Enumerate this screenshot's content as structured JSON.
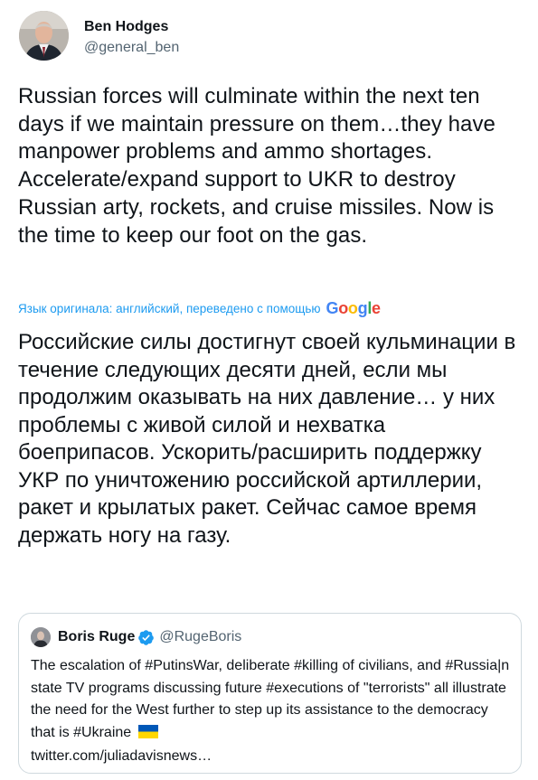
{
  "tweet": {
    "author": {
      "display_name": "Ben Hodges",
      "handle": "@general_ben"
    },
    "text": "Russian forces will culminate within the next ten days if we maintain pressure on them…they have manpower problems and ammo shortages. Accelerate/expand support to UKR to destroy Russian arty, rockets, and cruise missiles. Now is the time to keep our foot on the gas.",
    "translation_note": "Язык оригинала: английский, переведено с помощью",
    "translation_provider": "Google",
    "translated_text": "Российские силы достигнут своей кульминации в течение следующих десяти дней, если мы продолжим оказывать на них давление… у них проблемы с живой силой и нехватка боеприпасов. Ускорить/расширить поддержку УКР по уничтожению российской артиллерии, ракет и крылатых ракет. Сейчас самое время держать ногу на газу."
  },
  "quoted_tweet": {
    "author": {
      "display_name": "Boris Ruge",
      "handle": "@RugeBoris",
      "verified": true
    },
    "text": "The escalation of #PutinsWar, deliberate #killing of civilians, and #Russia|n state TV programs discussing future #executions of \"terrorists\" all illustrate the need for the West further to step up its assistance to the democracy that is #Ukraine",
    "link": "twitter.com/juliadavisnews…"
  },
  "colors": {
    "text": "#0f1419",
    "secondary_text": "#536471",
    "link_blue": "#1d9bf0",
    "border": "#cfd9de",
    "verified_badge": "#1d9bf0"
  },
  "icons": {
    "verified": "verified-badge-icon",
    "ukraine_flag": "ukraine-flag-emoji",
    "google": "google-logo"
  }
}
